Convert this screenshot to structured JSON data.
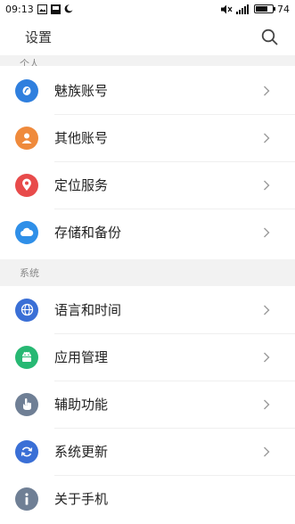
{
  "status_bar": {
    "time": "09:13",
    "battery_level": "74",
    "battery_fraction": 0.74
  },
  "header": {
    "title": "设置"
  },
  "sections": [
    {
      "label": "个人"
    },
    {
      "label": "系统"
    }
  ],
  "personal_items": [
    {
      "label": "魅族账号",
      "icon": "flyme-account-icon",
      "color": "#2f7fde"
    },
    {
      "label": "其他账号",
      "icon": "person-icon",
      "color": "#ef8a3c"
    },
    {
      "label": "定位服务",
      "icon": "location-pin-icon",
      "color": "#e84b4b"
    },
    {
      "label": "存储和备份",
      "icon": "cloud-icon",
      "color": "#2f8fe8"
    }
  ],
  "system_items": [
    {
      "label": "语言和时间",
      "icon": "globe-icon",
      "color": "#3a6fd6"
    },
    {
      "label": "应用管理",
      "icon": "android-robot-icon",
      "color": "#27b873"
    },
    {
      "label": "辅助功能",
      "icon": "hand-icon",
      "color": "#6f7f95"
    },
    {
      "label": "系统更新",
      "icon": "refresh-icon",
      "color": "#3a6fd6"
    },
    {
      "label": "关于手机",
      "icon": "info-icon",
      "color": "#6f7f95"
    }
  ]
}
